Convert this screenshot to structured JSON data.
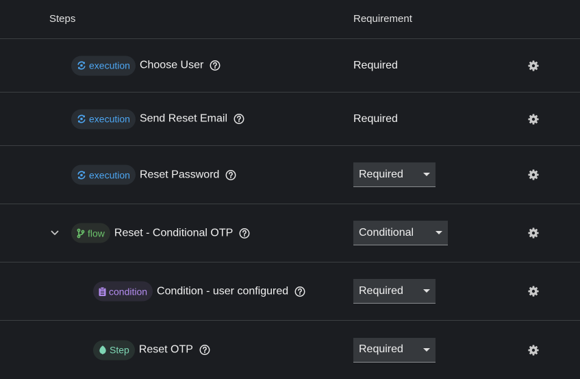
{
  "header": {
    "steps_label": "Steps",
    "requirement_label": "Requirement"
  },
  "colors": {
    "execution": "#4da6f2",
    "flow": "#6bc26b",
    "condition": "#b48df0",
    "step": "#7ed6b4",
    "background": "#1b1d21",
    "divider": "#3c3f42"
  },
  "rows": [
    {
      "chip": "execution",
      "name": "Choose User",
      "requirement": "Required",
      "requirement_control": "text",
      "icon": "refresh-icon"
    },
    {
      "chip": "execution",
      "name": "Send Reset Email",
      "requirement": "Required",
      "requirement_control": "text",
      "icon": "refresh-icon"
    },
    {
      "chip": "execution",
      "name": "Reset Password",
      "requirement": "Required",
      "requirement_control": "select",
      "icon": "refresh-icon"
    },
    {
      "chip": "flow",
      "name": "Reset - Conditional OTP",
      "requirement": "Conditional",
      "requirement_control": "select",
      "icon": "branch-icon",
      "expanded": true
    },
    {
      "chip": "condition",
      "name": "Condition - user configured",
      "requirement": "Required",
      "requirement_control": "select",
      "icon": "clipboard-icon"
    },
    {
      "chip": "Step",
      "name": "Reset OTP",
      "requirement": "Required",
      "requirement_control": "select",
      "icon": "leaf-icon"
    }
  ]
}
